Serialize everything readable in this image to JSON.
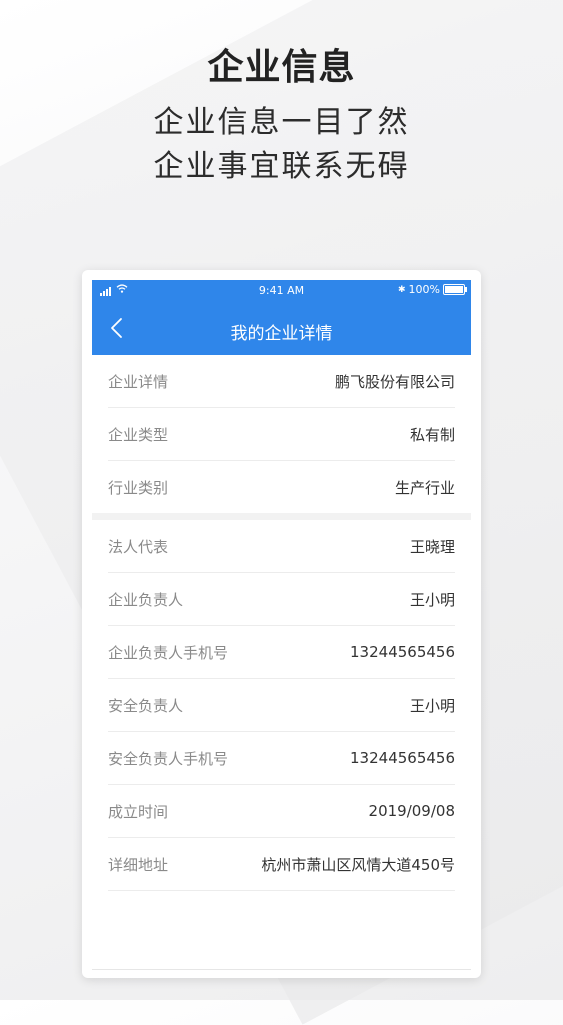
{
  "promo": {
    "title": "企业信息",
    "line1": "企业信息一目了然",
    "line2": "企业事宜联系无碍"
  },
  "status_bar": {
    "time": "9:41 AM",
    "battery_text": "100%",
    "bluetooth_glyph": "✱"
  },
  "nav": {
    "title": "我的企业详情",
    "back_icon": "chevron-left-icon"
  },
  "section1": [
    {
      "label": "企业详情",
      "value": "鹏飞股份有限公司"
    },
    {
      "label": "企业类型",
      "value": "私有制"
    },
    {
      "label": "行业类别",
      "value": "生产行业"
    }
  ],
  "section2": [
    {
      "label": "法人代表",
      "value": "王晓理"
    },
    {
      "label": "企业负责人",
      "value": "王小明"
    },
    {
      "label": "企业负责人手机号",
      "value": "13244565456"
    },
    {
      "label": "安全负责人",
      "value": "王小明"
    },
    {
      "label": "安全负责人手机号",
      "value": "13244565456"
    },
    {
      "label": "成立时间",
      "value": "2019/09/08"
    },
    {
      "label": "详细地址",
      "value": "杭州市萧山区风情大道450号"
    }
  ],
  "colors": {
    "brand_blue": "#2f86ea",
    "label_gray": "#8a8a8a",
    "value_dark": "#333333"
  }
}
